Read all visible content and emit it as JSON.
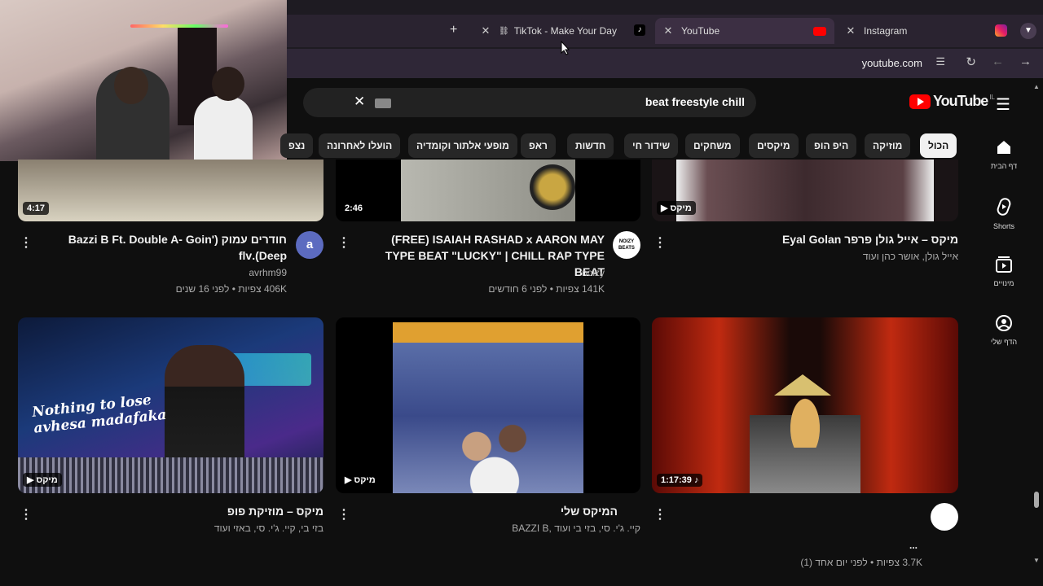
{
  "browser": {
    "tabs": [
      {
        "label": "TikTok - Make Your Day"
      },
      {
        "label": "YouTube"
      },
      {
        "label": "Instagram"
      }
    ],
    "url": "youtube.com"
  },
  "youtube": {
    "logo_text": "YouTube",
    "region": "IL",
    "search_query": "beat freestyle chill",
    "chips": [
      "הכול",
      "מוזיקה",
      "היפ הופ",
      "מיקסים",
      "משחקים",
      "שידור חי",
      "חדשות",
      "ראפ",
      "מופעי אלתור וקומדיה",
      "הועלו לאחרונה",
      "נצפ"
    ],
    "nav": [
      {
        "label": "דף הבית"
      },
      {
        "label": "Shorts"
      },
      {
        "label": "מינויים"
      },
      {
        "label": "הדף שלי"
      }
    ]
  },
  "videos": [
    {
      "duration": "4:17",
      "title": "חודרים עמוק (Bazzi B Ft. Double A- Goin' Deep).flv",
      "channel": "avrhm99",
      "stats": "406K צפיות • לפני 16 שנים",
      "avatar_letter": "a"
    },
    {
      "duration": "2:46",
      "title": "(FREE) ISAIAH RASHAD x AARON MAY TYPE BEAT \"LUCKY\" | CHILL RAP TYPE BEAT",
      "channel": "noizy",
      "stats": "141K צפיות • לפני 6 חודשים",
      "avatar_text": "NOIZY BEATS"
    },
    {
      "duration": "מיקס",
      "title": "מיקס – אייל גולן פרפר Eyal Golan",
      "channel": "אייל גולן, אושר כהן ועוד"
    },
    {
      "duration": "מיקס",
      "title": "מיקס – מוזיקת פופ",
      "channel": "בזי בי, קיי. ג'י. סי, באזי ועוד",
      "overlay": [
        "Nothing to lose",
        "avhesa madafaka"
      ]
    },
    {
      "duration": "מיקס",
      "title": "המיקס שלי",
      "channel": "קיי. ג'י. סי, בזי בי ועוד ,BAZZI B"
    },
    {
      "duration": "1:17:39",
      "title": "...",
      "stats": "3.7K צפיות • לפני יום אחד (1)"
    }
  ]
}
